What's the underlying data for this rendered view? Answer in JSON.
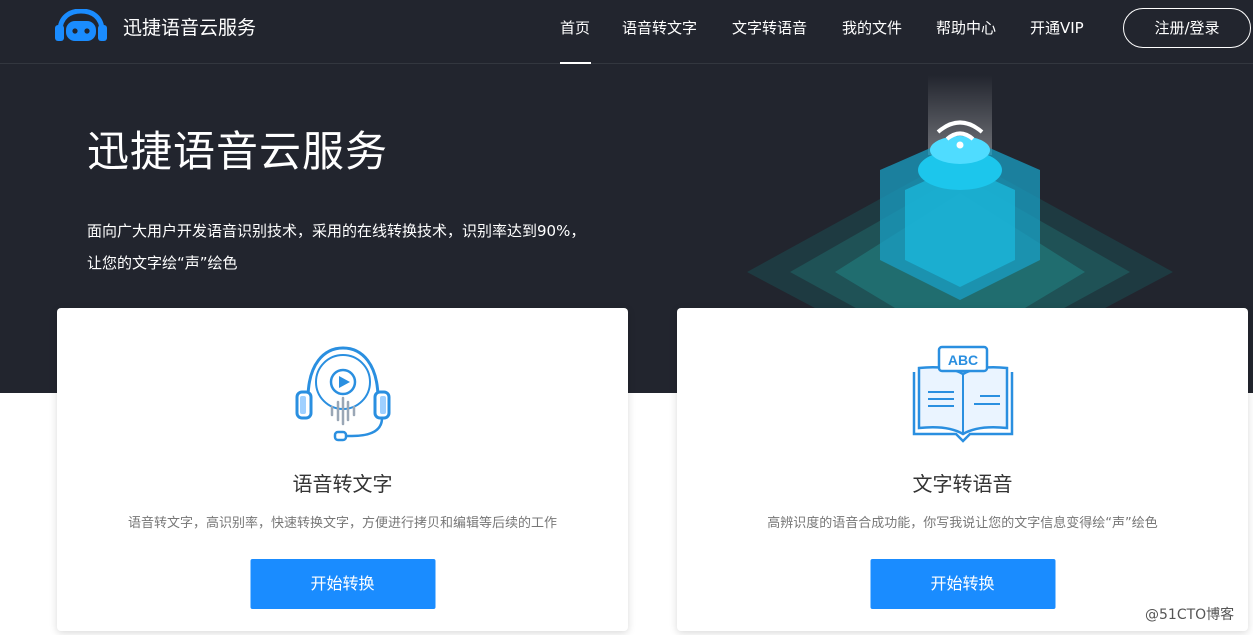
{
  "header": {
    "brand": "迅捷语音云服务",
    "logo_icon": "headset-robot-logo",
    "nav": [
      {
        "label": "首页",
        "active": true
      },
      {
        "label": "语音转文字"
      },
      {
        "label": "文字转语音"
      },
      {
        "label": "我的文件"
      },
      {
        "label": "帮助中心"
      },
      {
        "label": "开通VIP"
      }
    ],
    "login_label": "注册/登录"
  },
  "hero": {
    "title": "迅捷语音云服务",
    "description": "面向广大用户开发语音识别技术，采用的在线转换技术，识别率达到90%，让您的文字绘“声”绘色",
    "graphic_icon": "voice-signal-cube-icon"
  },
  "cards": [
    {
      "icon": "headset-microphone-icon",
      "title": "语音转文字",
      "description": "语音转文字，高识别率，快速转换文字，方便进行拷贝和编辑等后续的工作",
      "button_label": "开始转换"
    },
    {
      "icon": "book-abc-icon",
      "title": "文字转语音",
      "description": "高辨识度的语音合成功能，你写我说让您的文字信息变得绘“声”绘色",
      "button_label": "开始转换"
    }
  ],
  "watermark": "@51CTO博客",
  "colors": {
    "hero_background": "#22252e",
    "accent": "#1a8cff",
    "hero_graphic": "#1bb3d6"
  }
}
